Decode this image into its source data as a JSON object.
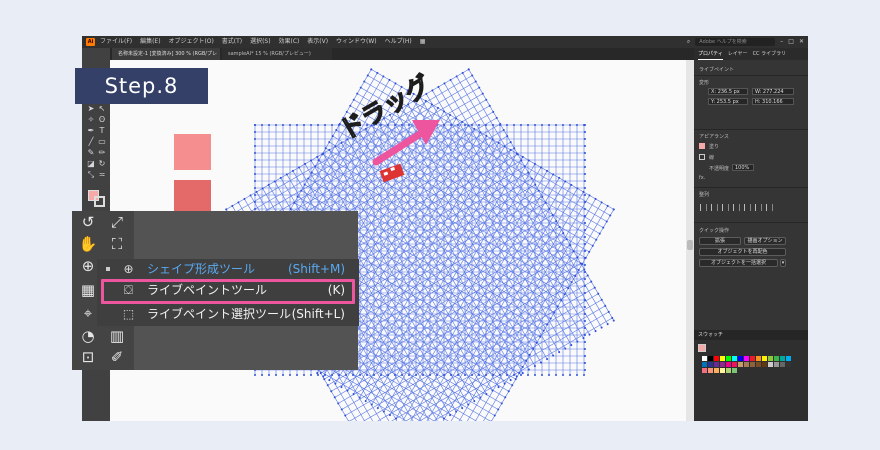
{
  "step_badge": "Step.8",
  "annotation": {
    "drag_label": "ドラッグ"
  },
  "menubar": {
    "items": [
      "ファイル(F)",
      "編集(E)",
      "オブジェクト(O)",
      "書式(T)",
      "選択(S)",
      "効果(C)",
      "表示(V)",
      "ウィンドウ(W)",
      "ヘルプ(H)"
    ],
    "search_placeholder": "Adobe ヘルプを検索"
  },
  "doc_tabs": [
    {
      "label": "名称未設定-1 [変換済み] 300 % (RGB/プレビュー)"
    },
    {
      "label": "sampleAI* 15 % (RGB/プレビュー)"
    }
  ],
  "flyout_menu": {
    "items": [
      {
        "label": "シェイプ形成ツール",
        "shortcut": "(Shift+M)",
        "icon": "shape-builder-icon"
      },
      {
        "label": "ライブペイントツール",
        "shortcut": "(K)",
        "icon": "live-paint-bucket-icon"
      },
      {
        "label": "ライブペイント選択ツール",
        "shortcut": "(Shift+L)",
        "icon": "live-paint-selection-icon"
      }
    ],
    "highlight_color": "#ee559f",
    "active_color": "#5aa9f0"
  },
  "properties_panel": {
    "tabs": [
      "プロパティ",
      "レイヤー",
      "CC ライブラリ"
    ],
    "selection_title": "ライブペイント",
    "transform_label": "変形",
    "x": "X: 236.5 px",
    "y": "Y: 253.5 px",
    "w": "W: 277.224",
    "h": "H: 310.166",
    "appearance_label": "アピアランス",
    "fill_label": "塗り",
    "stroke_label": "線",
    "opacity_label": "不透明度",
    "opacity_value": "100%",
    "align_label": "整列",
    "quick_actions_label": "クイック操作",
    "btn_expand": "拡張",
    "btn_options": "描画オプション",
    "btn_release": "オブジェクトを再配色",
    "btn_arrange": "オブジェクトを一括選択"
  },
  "swatches_panel": {
    "title": "スウォッチ",
    "colors": [
      "#ffffff",
      "#000000",
      "#ff0000",
      "#ffff00",
      "#00ff00",
      "#00ffff",
      "#0000ff",
      "#ff00ff",
      "#ed1c24",
      "#f7941d",
      "#fff200",
      "#8dc63f",
      "#39b54a",
      "#00a99d",
      "#00aeef",
      "#0072bc",
      "#2e3192",
      "#662d91",
      "#92278f",
      "#ec008c",
      "#ed145b",
      "#c69c6d",
      "#a67c52",
      "#8c6239",
      "#754c24",
      "#603913",
      "#cccccc",
      "#999999",
      "#666666",
      "#333333",
      "#f26d7d",
      "#f69679",
      "#fbaf5d",
      "#fff799",
      "#acd373",
      "#7cc576"
    ]
  }
}
